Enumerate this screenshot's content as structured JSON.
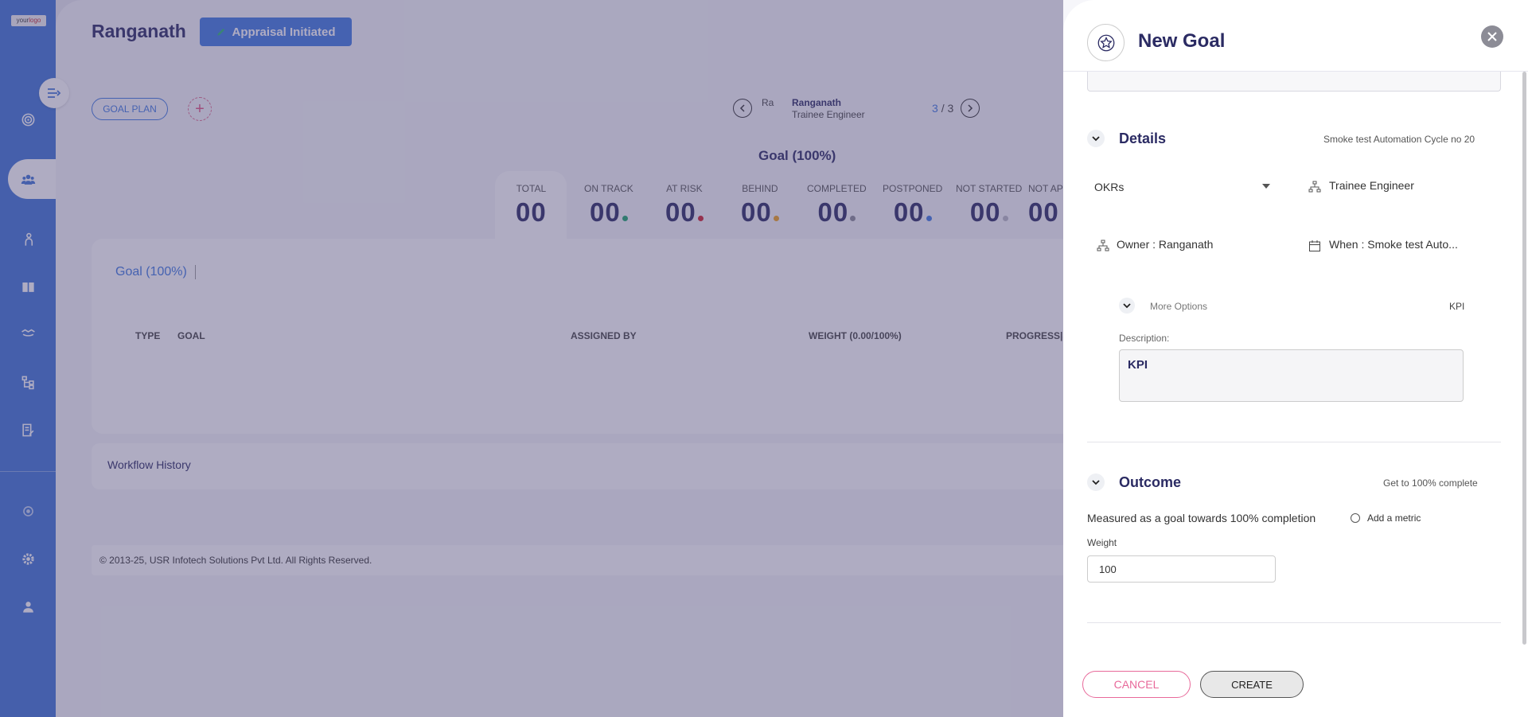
{
  "brand": {
    "logo_text_a": "your",
    "logo_text_b": "logo"
  },
  "header": {
    "employee_name": "Ranganath",
    "status_badge": "Appraisal Initiated"
  },
  "toolbar": {
    "goal_plan_label": "GOAL PLAN",
    "add_symbol": "+"
  },
  "navigator": {
    "avatar_alt": "Ra",
    "name": "Ranganath",
    "role": "Trainee Engineer",
    "current": "3",
    "separator": "/",
    "total": "3"
  },
  "summary": {
    "heading": "Goal (100%)",
    "stats": [
      {
        "label": "TOTAL",
        "value": "00",
        "dot_color": ""
      },
      {
        "label": "ON TRACK",
        "value": "00",
        "dot_color": "#1aa56b"
      },
      {
        "label": "AT RISK",
        "value": "00",
        "dot_color": "#d0202c"
      },
      {
        "label": "BEHIND",
        "value": "00",
        "dot_color": "#f0a01a"
      },
      {
        "label": "COMPLETED",
        "value": "00",
        "dot_color": "#8a8a96"
      },
      {
        "label": "POSTPONED",
        "value": "00",
        "dot_color": "#3f78e0"
      },
      {
        "label": "NOT STARTED",
        "value": "00",
        "dot_color": "#b8b8c4"
      },
      {
        "label": "NOT APPLICABLE",
        "value": "00",
        "dot_color": ""
      }
    ]
  },
  "goals_table": {
    "title": "Goal (100%)",
    "columns": [
      "TYPE",
      "GOAL",
      "ASSIGNED BY",
      "WEIGHT (0.00/100%)",
      "PROGRESS|STATUS"
    ]
  },
  "workflow": {
    "title": "Workflow History"
  },
  "footer": {
    "copyright": "© 2013-25, USR Infotech Solutions Pvt Ltd. All Rights Reserved."
  },
  "panel": {
    "title": "New Goal",
    "details": {
      "title": "Details",
      "cycle": "Smoke test Automation Cycle no 20",
      "type_value": "OKRs",
      "role": "Trainee Engineer",
      "owner": "Owner : Ranganath",
      "when": "When : Smoke test Auto...",
      "more_options": "More Options",
      "more_options_value": "KPI",
      "description_label": "Description:",
      "description_value": "KPI"
    },
    "outcome": {
      "title": "Outcome",
      "sub": "Get to 100% complete",
      "measured": "Measured as a goal towards 100% completion",
      "add_metric": "Add a metric",
      "weight_label": "Weight",
      "weight_value": "100"
    },
    "actions": {
      "cancel": "CANCEL",
      "create": "CREATE"
    }
  },
  "colors": {
    "accent": "#3f78e0",
    "sidebar": "#3e74d6",
    "cancel": "#e8699a"
  }
}
